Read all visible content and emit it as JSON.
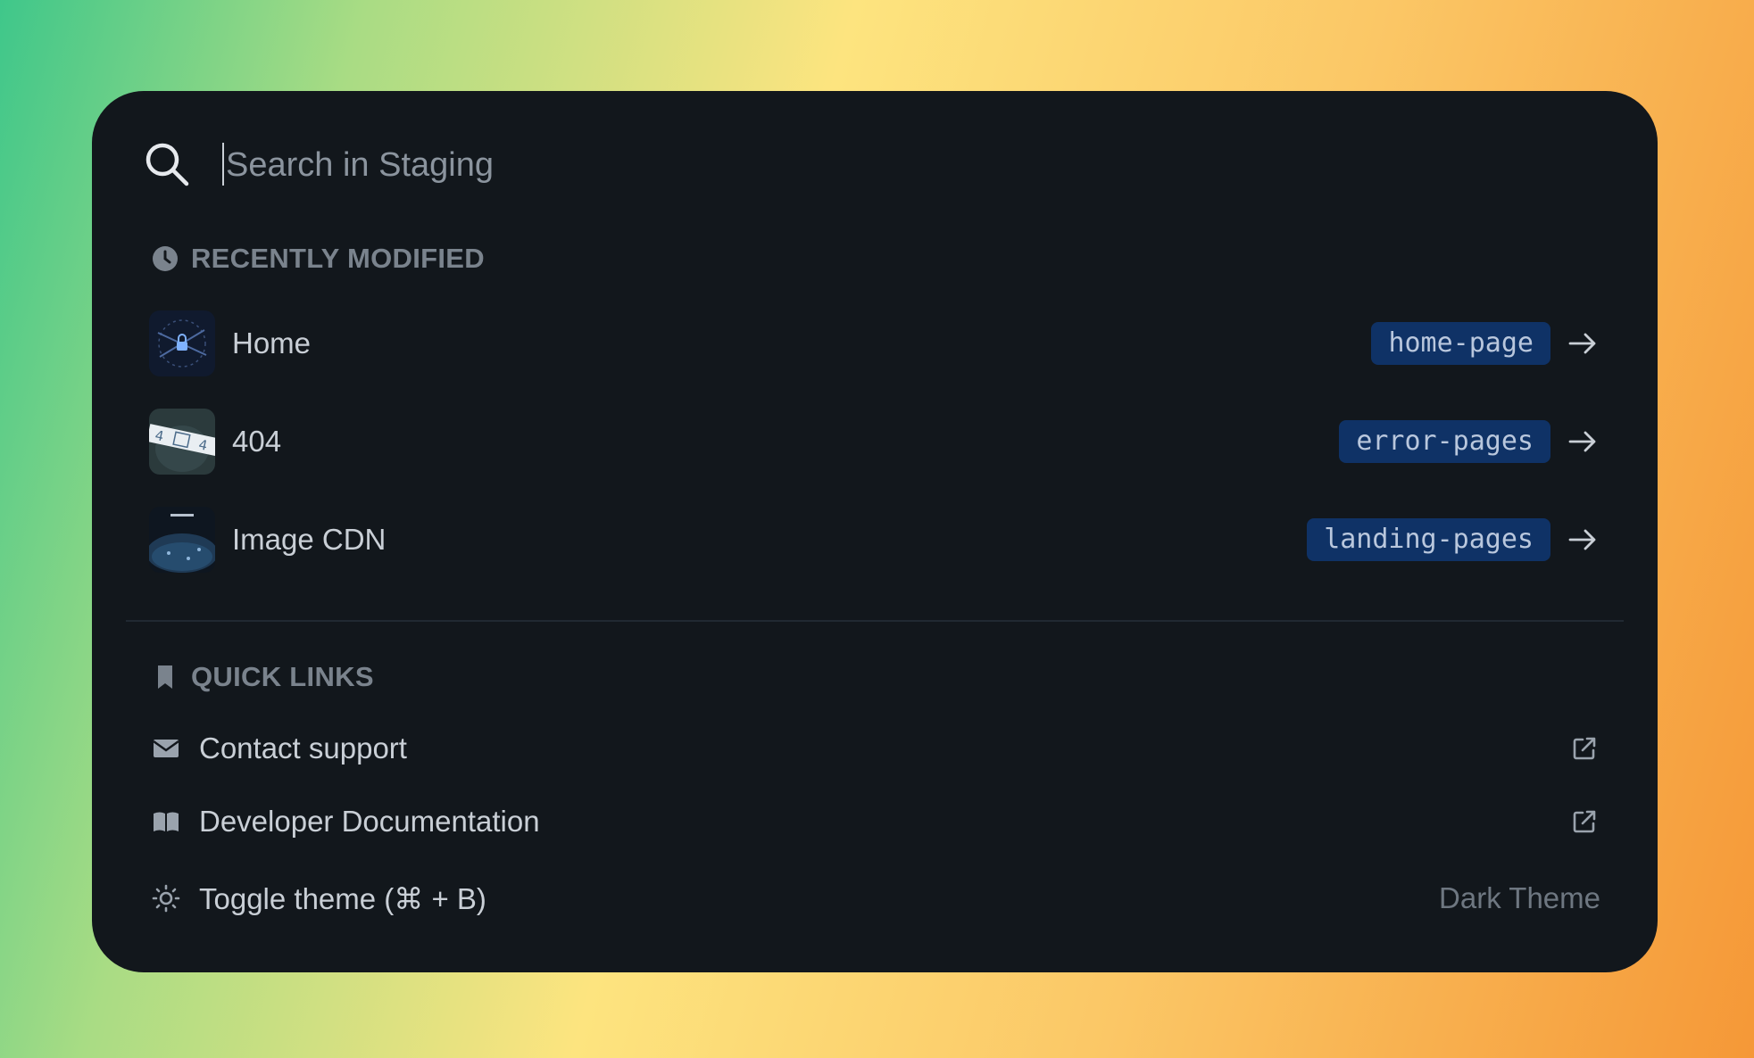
{
  "search": {
    "placeholder": "Search in Staging"
  },
  "recently_modified": {
    "title": "RECENTLY MODIFIED",
    "items": [
      {
        "label": "Home",
        "tag": "home-page"
      },
      {
        "label": "404",
        "tag": "error-pages"
      },
      {
        "label": "Image CDN",
        "tag": "landing-pages"
      }
    ]
  },
  "quick_links": {
    "title": "QUICK LINKS",
    "items": [
      {
        "label": "Contact support",
        "icon": "envelope-icon"
      },
      {
        "label": "Developer Documentation",
        "icon": "book-icon"
      }
    ],
    "theme_toggle": {
      "label": "Toggle theme (⌘ + B)",
      "value": "Dark Theme",
      "icon": "sun-icon"
    }
  },
  "colors": {
    "panel": "#12171c",
    "tag_bg": "#0f3266",
    "text": "#c9cfd6",
    "muted": "#7a838d"
  }
}
